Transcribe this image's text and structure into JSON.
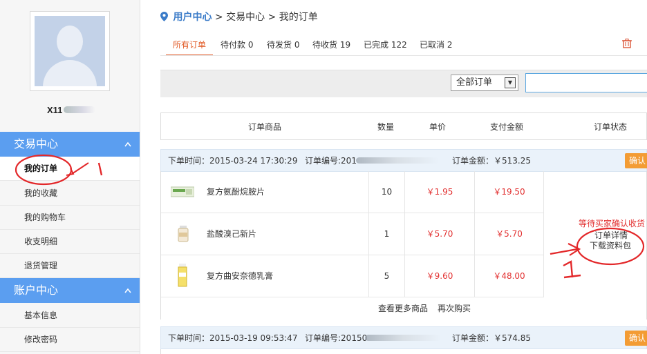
{
  "sidebar": {
    "username": "X11",
    "sections": [
      {
        "title": "交易中心",
        "items": [
          "我的订单",
          "我的收藏",
          "我的购物车",
          "收支明细",
          "退货管理"
        ]
      },
      {
        "title": "账户中心",
        "items": [
          "基本信息",
          "修改密码"
        ]
      }
    ]
  },
  "breadcrumb": {
    "home": "用户中心",
    "sep": ">",
    "level2": "交易中心",
    "level3": "我的订单"
  },
  "tabs": [
    {
      "label": "所有订单"
    },
    {
      "label": "待付款 0"
    },
    {
      "label": "待发货 0"
    },
    {
      "label": "待收货 19"
    },
    {
      "label": "已完成 122"
    },
    {
      "label": "已取消 2"
    }
  ],
  "filter": {
    "select_value": "全部订单"
  },
  "table_headers": [
    "订单商品",
    "数量",
    "单价",
    "支付金额",
    "订单状态"
  ],
  "orders": [
    {
      "time": "下单时间：2015-03-24 17:30:29",
      "number": "订单编号:201",
      "amount": "订单金额：￥513.25",
      "confirm": "确认",
      "items": [
        {
          "name": "复方氨酚烷胺片",
          "qty": "10",
          "price": "￥1.95",
          "total": "￥19.50"
        },
        {
          "name": "盐酸溴己新片",
          "qty": "1",
          "price": "￥5.70",
          "total": "￥5.70"
        },
        {
          "name": "复方曲安奈德乳膏",
          "qty": "5",
          "price": "￥9.60",
          "total": "￥48.00"
        }
      ],
      "status": "等待买家确认收货",
      "detail": "订单详情",
      "download": "下载资料包",
      "more": "查看更多商品",
      "rebuy": "再次购买"
    },
    {
      "time": "下单时间：2015-03-19 09:53:47",
      "number": "订单编号:20150",
      "amount": "订单金额：￥574.85",
      "confirm": "确认"
    }
  ],
  "annotations": {
    "mark1": "1",
    "mark2": "1"
  },
  "colors": {
    "accent_blue": "#5b9ef0",
    "accent_orange": "#e15b27",
    "price_red": "#e23030",
    "annotation_red": "#e3282a"
  }
}
